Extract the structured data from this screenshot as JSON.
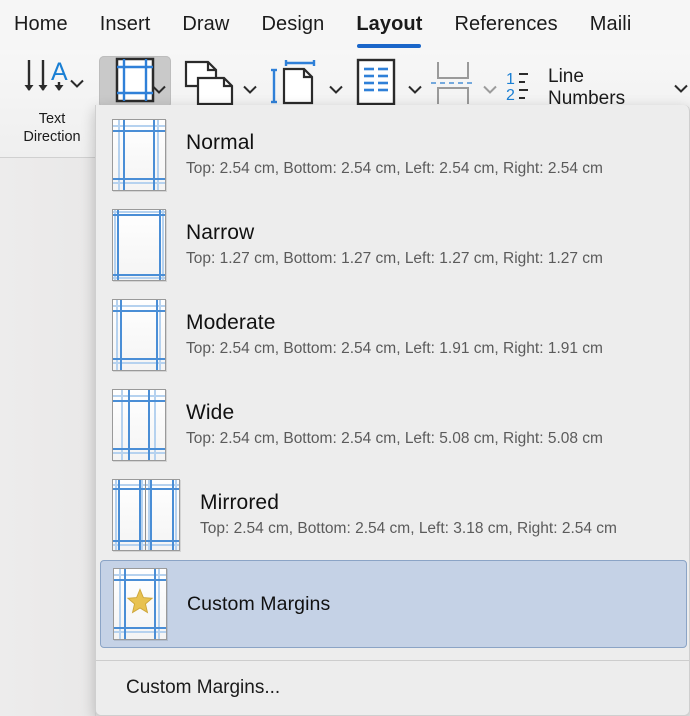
{
  "ribbon_tabs": [
    {
      "label": "Home",
      "active": false
    },
    {
      "label": "Insert",
      "active": false
    },
    {
      "label": "Draw",
      "active": false
    },
    {
      "label": "Design",
      "active": false
    },
    {
      "label": "Layout",
      "active": true
    },
    {
      "label": "References",
      "active": false
    },
    {
      "label": "Maili",
      "active": false
    }
  ],
  "toolbar": {
    "text_direction_label_line1": "Text",
    "text_direction_label_line2": "Direction",
    "margins_icon": "margins-icon",
    "orientation_icon": "orientation-icon",
    "size_icon": "page-size-icon",
    "columns_icon": "columns-icon",
    "breaks_icon": "breaks-icon",
    "line_numbers_icon": "line-numbers-icon",
    "line_numbers_label": "Line Numbers"
  },
  "menu": {
    "items": [
      {
        "title": "Normal",
        "subtitle": "Top: 2.54 cm, Bottom: 2.54 cm, Left: 2.54 cm, Right: 2.54 cm",
        "selected": false,
        "icon": "margin-preset-normal-icon"
      },
      {
        "title": "Narrow",
        "subtitle": "Top: 1.27 cm, Bottom: 1.27 cm, Left: 1.27 cm, Right: 1.27 cm",
        "selected": false,
        "icon": "margin-preset-narrow-icon"
      },
      {
        "title": "Moderate",
        "subtitle": "Top: 2.54 cm, Bottom: 2.54 cm, Left: 1.91 cm, Right: 1.91 cm",
        "selected": false,
        "icon": "margin-preset-moderate-icon"
      },
      {
        "title": "Wide",
        "subtitle": "Top: 2.54 cm, Bottom: 2.54 cm, Left: 5.08 cm, Right: 5.08 cm",
        "selected": false,
        "icon": "margin-preset-wide-icon"
      },
      {
        "title": "Mirrored",
        "subtitle": "Top: 2.54 cm, Bottom: 2.54 cm, Left: 3.18 cm, Right: 2.54 cm",
        "selected": false,
        "icon": "margin-preset-mirrored-icon"
      },
      {
        "title": "Custom Margins",
        "subtitle": "",
        "selected": true,
        "icon": "margin-preset-custom-star-icon"
      }
    ],
    "footer_label": "Custom Margins..."
  },
  "colors": {
    "accent": "#1a66c9",
    "margin_line": "#4a8ed6",
    "margin_line_pale": "#b6d2ef",
    "selection_fill": "#c5d2e6",
    "selection_border": "#8ba4c6",
    "star": "#e8c251",
    "menu_bg": "#ededed",
    "ribbon_bg": "#f6f6f6"
  }
}
